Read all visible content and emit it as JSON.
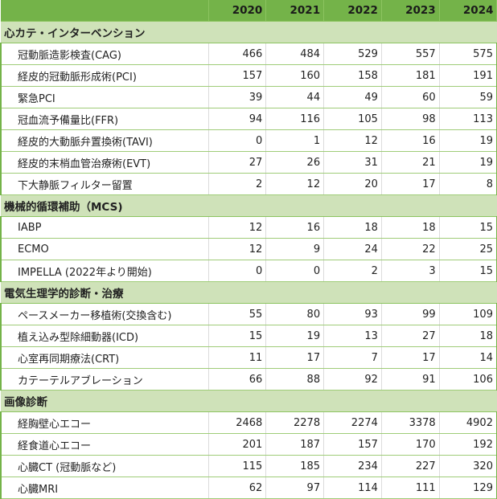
{
  "table": {
    "years": [
      "2020",
      "2021",
      "2022",
      "2023",
      "2024"
    ],
    "sections": [
      {
        "title": "心カテ・インターベンション",
        "rows": [
          {
            "label": "冠動脈造影検査(CAG)",
            "values": [
              "466",
              "484",
              "529",
              "557",
              "575"
            ]
          },
          {
            "label": "経皮的冠動脈形成術(PCI)",
            "values": [
              "157",
              "160",
              "158",
              "181",
              "191"
            ]
          },
          {
            "label": "緊急PCI",
            "values": [
              "39",
              "44",
              "49",
              "60",
              "59"
            ]
          },
          {
            "label": "冠血流予備量比(FFR)",
            "values": [
              "94",
              "116",
              "105",
              "98",
              "113"
            ]
          },
          {
            "label": "経皮的大動脈弁置換術(TAVI)",
            "values": [
              "0",
              "1",
              "12",
              "16",
              "19"
            ]
          },
          {
            "label": "経皮的末梢血管治療術(EVT)",
            "values": [
              "27",
              "26",
              "31",
              "21",
              "19"
            ]
          },
          {
            "label": "下大静脈フィルター留置",
            "values": [
              "2",
              "12",
              "20",
              "17",
              "8"
            ]
          }
        ]
      },
      {
        "title": "機械的循環補助（MCS)",
        "rows": [
          {
            "label": "IABP",
            "values": [
              "12",
              "16",
              "18",
              "18",
              "15"
            ]
          },
          {
            "label": "ECMO",
            "values": [
              "12",
              "9",
              "24",
              "22",
              "25"
            ]
          },
          {
            "label": "IMPELLA (2022年より開始)",
            "values": [
              "0",
              "0",
              "2",
              "3",
              "15"
            ]
          }
        ]
      },
      {
        "title": "電気生理学的診断・治療",
        "rows": [
          {
            "label": "ペースメーカー移植術(交換含む)",
            "values": [
              "55",
              "80",
              "93",
              "99",
              "109"
            ]
          },
          {
            "label": "植え込み型除細動器(ICD)",
            "values": [
              "15",
              "19",
              "13",
              "27",
              "18"
            ]
          },
          {
            "label": "心室再同期療法(CRT)",
            "values": [
              "11",
              "17",
              "7",
              "17",
              "14"
            ]
          },
          {
            "label": "カテーテルアブレーション",
            "values": [
              "66",
              "88",
              "92",
              "91",
              "106"
            ]
          }
        ]
      },
      {
        "title": "画像診断",
        "rows": [
          {
            "label": "経胸壁心エコー",
            "values": [
              "2468",
              "2278",
              "2274",
              "3378",
              "4902"
            ]
          },
          {
            "label": "経食道心エコー",
            "values": [
              "201",
              "187",
              "157",
              "170",
              "192"
            ]
          },
          {
            "label": "心臓CT (冠動脈など)",
            "values": [
              "115",
              "185",
              "234",
              "227",
              "320"
            ]
          },
          {
            "label": "心臓MRI",
            "values": [
              "62",
              "97",
              "114",
              "111",
              "129"
            ]
          }
        ]
      }
    ]
  }
}
